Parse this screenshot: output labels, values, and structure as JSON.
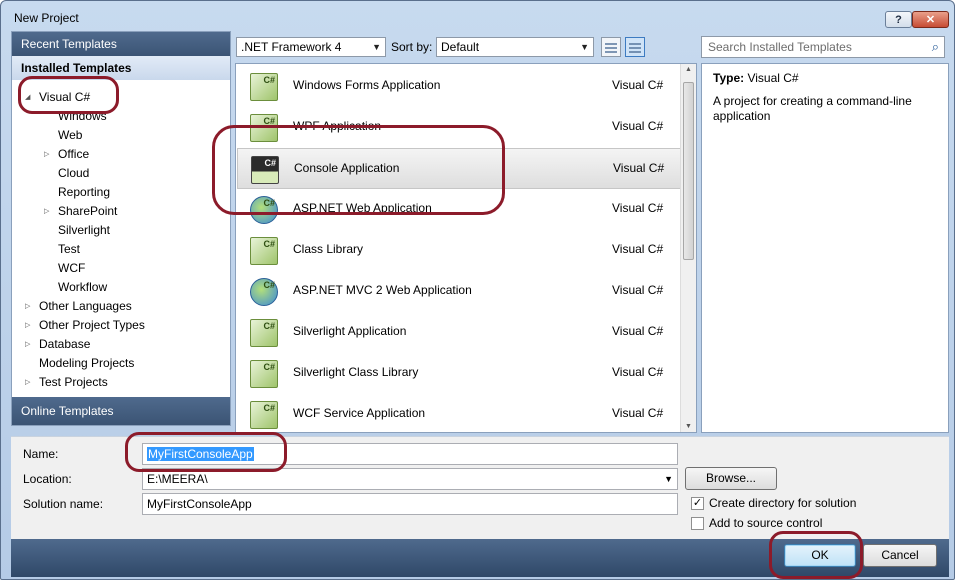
{
  "window": {
    "title": "New Project",
    "help_glyph": "?",
    "close_glyph": "✕"
  },
  "left_panel": {
    "recent_templates": "Recent Templates",
    "installed_templates": "Installed Templates",
    "online_templates": "Online Templates",
    "tree": [
      {
        "label": "Visual C#",
        "indent": 1,
        "expander": "expanded"
      },
      {
        "label": "Windows",
        "indent": 2,
        "expander": "none"
      },
      {
        "label": "Web",
        "indent": 2,
        "expander": "none"
      },
      {
        "label": "Office",
        "indent": 2,
        "expander": "collapsed"
      },
      {
        "label": "Cloud",
        "indent": 2,
        "expander": "none"
      },
      {
        "label": "Reporting",
        "indent": 2,
        "expander": "none"
      },
      {
        "label": "SharePoint",
        "indent": 2,
        "expander": "collapsed"
      },
      {
        "label": "Silverlight",
        "indent": 2,
        "expander": "none"
      },
      {
        "label": "Test",
        "indent": 2,
        "expander": "none"
      },
      {
        "label": "WCF",
        "indent": 2,
        "expander": "none"
      },
      {
        "label": "Workflow",
        "indent": 2,
        "expander": "none"
      },
      {
        "label": "Other Languages",
        "indent": 1,
        "expander": "collapsed"
      },
      {
        "label": "Other Project Types",
        "indent": 1,
        "expander": "collapsed"
      },
      {
        "label": "Database",
        "indent": 1,
        "expander": "collapsed"
      },
      {
        "label": "Modeling Projects",
        "indent": 1,
        "expander": "none"
      },
      {
        "label": "Test Projects",
        "indent": 1,
        "expander": "collapsed"
      }
    ]
  },
  "toolbar": {
    "framework": ".NET Framework 4",
    "sort_label": "Sort by:",
    "sort_value": "Default"
  },
  "templates": [
    {
      "name": "Windows Forms Application",
      "lang": "Visual C#",
      "icon": "winforms-icon"
    },
    {
      "name": "WPF Application",
      "lang": "Visual C#",
      "icon": "wpf-icon"
    },
    {
      "name": "Console Application",
      "lang": "Visual C#",
      "icon": "console-icon",
      "selected": true
    },
    {
      "name": "ASP.NET Web Application",
      "lang": "Visual C#",
      "icon": "globe-icon"
    },
    {
      "name": "Class Library",
      "lang": "Visual C#",
      "icon": "class-library-icon"
    },
    {
      "name": "ASP.NET MVC 2 Web Application",
      "lang": "Visual C#",
      "icon": "globe-icon"
    },
    {
      "name": "Silverlight Application",
      "lang": "Visual C#",
      "icon": "silverlight-icon"
    },
    {
      "name": "Silverlight Class Library",
      "lang": "Visual C#",
      "icon": "silverlight-library-icon"
    },
    {
      "name": "WCF Service Application",
      "lang": "Visual C#",
      "icon": "wcf-icon"
    }
  ],
  "icon_glyph": "C#",
  "search": {
    "placeholder": "Search Installed Templates"
  },
  "description": {
    "type_label": "Type:",
    "type_value": "Visual C#",
    "text": "A project for creating a command-line application"
  },
  "form": {
    "name_label": "Name:",
    "name_value": "MyFirstConsoleApp",
    "location_label": "Location:",
    "location_value": "E:\\MEERA\\",
    "solution_label": "Solution name:",
    "solution_value": "MyFirstConsoleApp",
    "browse_label": "Browse...",
    "create_dir_label": "Create directory for solution",
    "create_dir_checked": true,
    "source_control_label": "Add to source control",
    "source_control_checked": false
  },
  "buttons": {
    "ok": "OK",
    "cancel": "Cancel"
  },
  "colors": {
    "annotation": "#8c1b2a",
    "header": "#4f6a8d",
    "selection_text": "#3399ff"
  }
}
